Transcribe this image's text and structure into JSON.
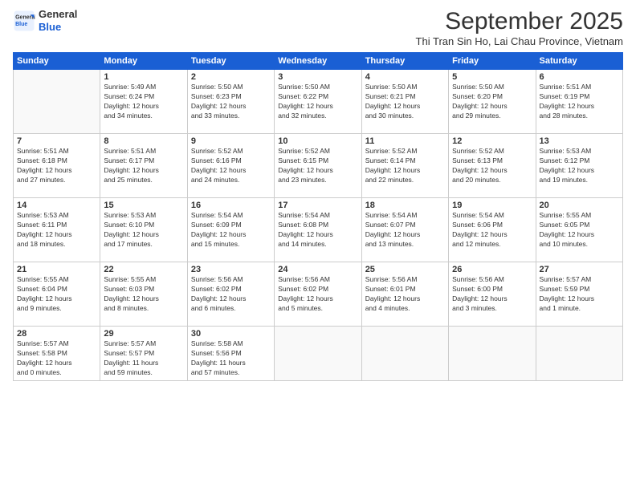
{
  "logo": {
    "line1": "General",
    "line2": "Blue"
  },
  "title": "September 2025",
  "subtitle": "Thi Tran Sin Ho, Lai Chau Province, Vietnam",
  "header_days": [
    "Sunday",
    "Monday",
    "Tuesday",
    "Wednesday",
    "Thursday",
    "Friday",
    "Saturday"
  ],
  "weeks": [
    [
      {
        "day": "",
        "info": ""
      },
      {
        "day": "1",
        "info": "Sunrise: 5:49 AM\nSunset: 6:24 PM\nDaylight: 12 hours\nand 34 minutes."
      },
      {
        "day": "2",
        "info": "Sunrise: 5:50 AM\nSunset: 6:23 PM\nDaylight: 12 hours\nand 33 minutes."
      },
      {
        "day": "3",
        "info": "Sunrise: 5:50 AM\nSunset: 6:22 PM\nDaylight: 12 hours\nand 32 minutes."
      },
      {
        "day": "4",
        "info": "Sunrise: 5:50 AM\nSunset: 6:21 PM\nDaylight: 12 hours\nand 30 minutes."
      },
      {
        "day": "5",
        "info": "Sunrise: 5:50 AM\nSunset: 6:20 PM\nDaylight: 12 hours\nand 29 minutes."
      },
      {
        "day": "6",
        "info": "Sunrise: 5:51 AM\nSunset: 6:19 PM\nDaylight: 12 hours\nand 28 minutes."
      }
    ],
    [
      {
        "day": "7",
        "info": "Sunrise: 5:51 AM\nSunset: 6:18 PM\nDaylight: 12 hours\nand 27 minutes."
      },
      {
        "day": "8",
        "info": "Sunrise: 5:51 AM\nSunset: 6:17 PM\nDaylight: 12 hours\nand 25 minutes."
      },
      {
        "day": "9",
        "info": "Sunrise: 5:52 AM\nSunset: 6:16 PM\nDaylight: 12 hours\nand 24 minutes."
      },
      {
        "day": "10",
        "info": "Sunrise: 5:52 AM\nSunset: 6:15 PM\nDaylight: 12 hours\nand 23 minutes."
      },
      {
        "day": "11",
        "info": "Sunrise: 5:52 AM\nSunset: 6:14 PM\nDaylight: 12 hours\nand 22 minutes."
      },
      {
        "day": "12",
        "info": "Sunrise: 5:52 AM\nSunset: 6:13 PM\nDaylight: 12 hours\nand 20 minutes."
      },
      {
        "day": "13",
        "info": "Sunrise: 5:53 AM\nSunset: 6:12 PM\nDaylight: 12 hours\nand 19 minutes."
      }
    ],
    [
      {
        "day": "14",
        "info": "Sunrise: 5:53 AM\nSunset: 6:11 PM\nDaylight: 12 hours\nand 18 minutes."
      },
      {
        "day": "15",
        "info": "Sunrise: 5:53 AM\nSunset: 6:10 PM\nDaylight: 12 hours\nand 17 minutes."
      },
      {
        "day": "16",
        "info": "Sunrise: 5:54 AM\nSunset: 6:09 PM\nDaylight: 12 hours\nand 15 minutes."
      },
      {
        "day": "17",
        "info": "Sunrise: 5:54 AM\nSunset: 6:08 PM\nDaylight: 12 hours\nand 14 minutes."
      },
      {
        "day": "18",
        "info": "Sunrise: 5:54 AM\nSunset: 6:07 PM\nDaylight: 12 hours\nand 13 minutes."
      },
      {
        "day": "19",
        "info": "Sunrise: 5:54 AM\nSunset: 6:06 PM\nDaylight: 12 hours\nand 12 minutes."
      },
      {
        "day": "20",
        "info": "Sunrise: 5:55 AM\nSunset: 6:05 PM\nDaylight: 12 hours\nand 10 minutes."
      }
    ],
    [
      {
        "day": "21",
        "info": "Sunrise: 5:55 AM\nSunset: 6:04 PM\nDaylight: 12 hours\nand 9 minutes."
      },
      {
        "day": "22",
        "info": "Sunrise: 5:55 AM\nSunset: 6:03 PM\nDaylight: 12 hours\nand 8 minutes."
      },
      {
        "day": "23",
        "info": "Sunrise: 5:56 AM\nSunset: 6:02 PM\nDaylight: 12 hours\nand 6 minutes."
      },
      {
        "day": "24",
        "info": "Sunrise: 5:56 AM\nSunset: 6:02 PM\nDaylight: 12 hours\nand 5 minutes."
      },
      {
        "day": "25",
        "info": "Sunrise: 5:56 AM\nSunset: 6:01 PM\nDaylight: 12 hours\nand 4 minutes."
      },
      {
        "day": "26",
        "info": "Sunrise: 5:56 AM\nSunset: 6:00 PM\nDaylight: 12 hours\nand 3 minutes."
      },
      {
        "day": "27",
        "info": "Sunrise: 5:57 AM\nSunset: 5:59 PM\nDaylight: 12 hours\nand 1 minute."
      }
    ],
    [
      {
        "day": "28",
        "info": "Sunrise: 5:57 AM\nSunset: 5:58 PM\nDaylight: 12 hours\nand 0 minutes."
      },
      {
        "day": "29",
        "info": "Sunrise: 5:57 AM\nSunset: 5:57 PM\nDaylight: 11 hours\nand 59 minutes."
      },
      {
        "day": "30",
        "info": "Sunrise: 5:58 AM\nSunset: 5:56 PM\nDaylight: 11 hours\nand 57 minutes."
      },
      {
        "day": "",
        "info": ""
      },
      {
        "day": "",
        "info": ""
      },
      {
        "day": "",
        "info": ""
      },
      {
        "day": "",
        "info": ""
      }
    ]
  ]
}
